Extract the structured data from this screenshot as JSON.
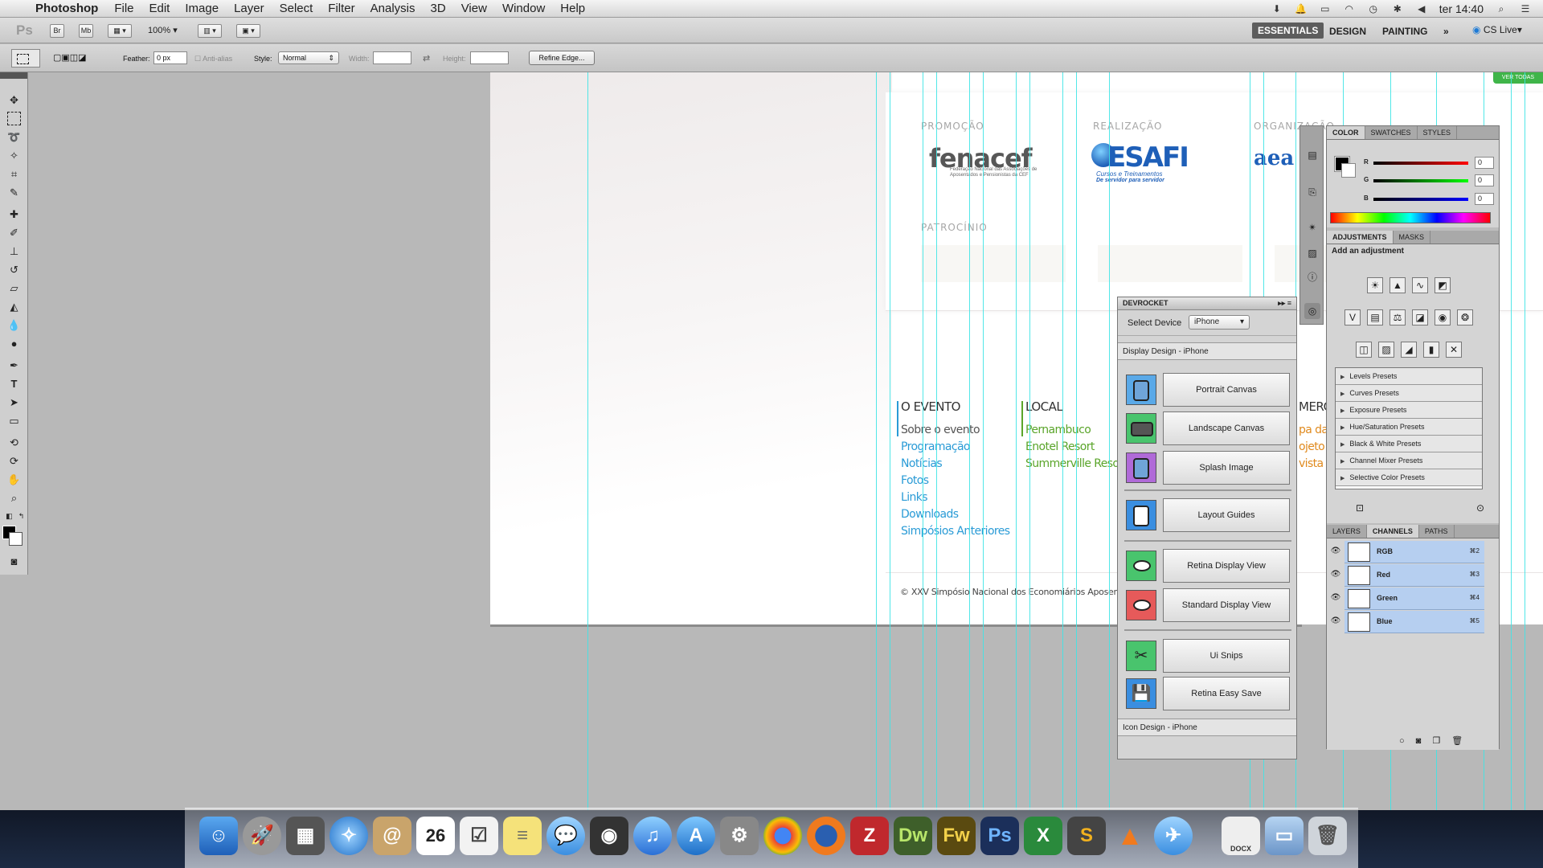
{
  "menubar": {
    "app_name": "Photoshop",
    "menus": [
      "File",
      "Edit",
      "Image",
      "Layer",
      "Select",
      "Filter",
      "Analysis",
      "3D",
      "View",
      "Window",
      "Help"
    ],
    "clock": "ter 14:40"
  },
  "appbar": {
    "ps_label": "Ps",
    "br_label": "Br",
    "mb_label": "Mb",
    "zoom": "100%",
    "workspaces": [
      "ESSENTIALS",
      "DESIGN",
      "PAINTING"
    ],
    "more": "»",
    "cs_live": "CS Live"
  },
  "options": {
    "feather_label": "Feather:",
    "feather_value": "0 px",
    "antialias_label": "Anti-alias",
    "style_label": "Style:",
    "style_value": "Normal",
    "width_label": "Width:",
    "height_label": "Height:",
    "refine_edge": "Refine Edge..."
  },
  "canvas": {
    "ver_todas": "VER TODAS",
    "promocao": "PROMOÇÃO",
    "realizacao": "REALIZAÇÃO",
    "organizacao": "ORGANIZAÇÃO",
    "patrocinio": "PATROCÍNIO",
    "fenacef_logo": "fenacef",
    "fenacef_sub": "Federação Nacional das Associações de Aposentados e Pensionistas da CEF",
    "esafi_logo": "ESAFI",
    "esafi_tag1": "Cursos e Treinamentos",
    "esafi_tag2": "De servidor para servidor",
    "aea_logo": "aea",
    "col_evento": {
      "title": "O EVENTO",
      "links": [
        "Sobre o evento",
        "Programação",
        "Notícias",
        "Fotos",
        "Links",
        "Downloads",
        "Simpósios Anteriores"
      ]
    },
    "col_local": {
      "title": "LOCAL",
      "links": [
        "Pernambuco",
        "Enotel Resort",
        "Summerville Resort"
      ]
    },
    "col_merc": {
      "title": "MERC",
      "links": [
        "pa da",
        "ojeto c",
        "vista"
      ]
    },
    "copyright": "© XXV Simpósio Nacional dos Economiários Aposentados e"
  },
  "devrocket": {
    "title": "DEVROCKET",
    "select_label": "Select Device",
    "device": "iPhone",
    "display_section": "Display Design - iPhone",
    "buttons": [
      "Portrait Canvas",
      "Landscape Canvas",
      "Splash Image",
      "Layout Guides",
      "Retina Display View",
      "Standard Display View",
      "Ui Snips",
      "Retina Easy Save"
    ],
    "icon_section": "Icon Design - iPhone"
  },
  "color_panel": {
    "tabs": [
      "COLOR",
      "SWATCHES",
      "STYLES"
    ],
    "channels": [
      {
        "name": "R",
        "value": "0"
      },
      {
        "name": "G",
        "value": "0"
      },
      {
        "name": "B",
        "value": "0"
      }
    ]
  },
  "adjustments": {
    "tabs": [
      "ADJUSTMENTS",
      "MASKS"
    ],
    "heading": "Add an adjustment",
    "presets": [
      "Levels Presets",
      "Curves Presets",
      "Exposure Presets",
      "Hue/Saturation Presets",
      "Black & White Presets",
      "Channel Mixer Presets",
      "Selective Color Presets"
    ]
  },
  "layers": {
    "tabs": [
      "LAYERS",
      "CHANNELS",
      "PATHS"
    ],
    "channels": [
      {
        "name": "RGB",
        "shortcut": "⌘2"
      },
      {
        "name": "Red",
        "shortcut": "⌘3"
      },
      {
        "name": "Green",
        "shortcut": "⌘4"
      },
      {
        "name": "Blue",
        "shortcut": "⌘5"
      }
    ]
  },
  "dock": {
    "calendar_day": "26",
    "docx_label": "DOCX",
    "dw": "Dw",
    "fw": "Fw",
    "ps": "Ps"
  },
  "colors": {
    "guide": "#3fe4e6",
    "link_blue": "#2a9bd6",
    "link_green": "#5aa52a",
    "link_orange": "#e08a1e",
    "selection": "#b6cff0"
  }
}
